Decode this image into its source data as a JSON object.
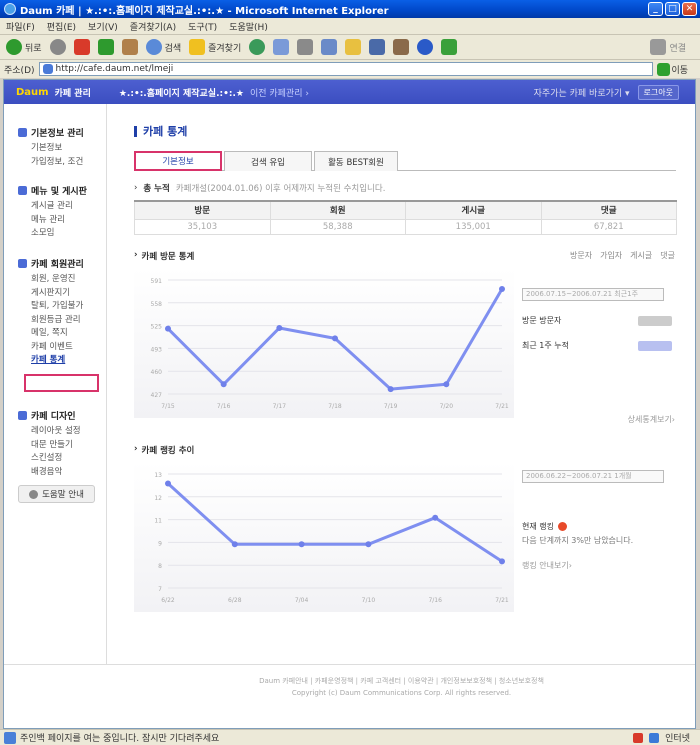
{
  "window": {
    "title": "Daum 카페 | ★.:•:.홈페이지 제작교실.:•:.★ - Microsoft Internet Explorer"
  },
  "menu": [
    "파일(F)",
    "편집(E)",
    "보기(V)",
    "즐겨찾기(A)",
    "도구(T)",
    "도움말(H)"
  ],
  "toolbar": {
    "back": "뒤로",
    "search": "검색",
    "favorites": "즐겨찾기",
    "connect": "연결"
  },
  "address": {
    "label": "주소(D)",
    "url": "http://cafe.daum.net/lmeji",
    "go": "이동"
  },
  "cafebar": {
    "logo": "Daum",
    "title": "카페 관리",
    "cafe_name": "★.:•:.홈페이지 제작교실.:•:.★",
    "prev": "이전 카페관리 ›",
    "favorite_cafes": "자주가는 카페 바로가기 ▾",
    "logout": "로그아웃"
  },
  "sidebar": {
    "basic": {
      "title": "기본정보 관리",
      "items": [
        "기본정보",
        "가입정보, 조건"
      ]
    },
    "menu": {
      "title": "메뉴 및 게시판",
      "items": [
        "게시글 관리",
        "메뉴 관리",
        "소모임"
      ]
    },
    "members": {
      "title": "카페 회원관리",
      "items": [
        "회원, 운영진",
        "게시판지기",
        "탈퇴, 가입불가",
        "회원등급 관리",
        "메일, 쪽지",
        "카페 이벤트",
        "카페 통계"
      ]
    },
    "design": {
      "title": "카페 디자인",
      "items": [
        "레이아웃 설정",
        "대문 만들기",
        "스킨설정",
        "배경음악"
      ]
    },
    "help": "도움말 안내"
  },
  "content": {
    "title": "카페 통계",
    "tabs": [
      "기본정보",
      "검색 유입",
      "활동 BEST회원"
    ],
    "summary_label": "총 누적",
    "summary_desc": "카페개설(2004.01.06) 이후 어제까지 누적된 수치입니다.",
    "stats_headers": [
      "방문",
      "회원",
      "게시글",
      "댓글"
    ],
    "stats_values": [
      "35,103",
      "58,388",
      "135,001",
      "67,821"
    ],
    "chart1": {
      "title": "카페 방문 통계",
      "links": [
        "방문자",
        "가입자",
        "게시글",
        "댓글"
      ],
      "date_range": "2006.07.15~2006.07.21 최근1주",
      "visitors_label": "방문 방문자",
      "cumulative_label": "최근 1주 누적",
      "more": "상세통계보기›"
    },
    "chart2": {
      "title": "카페 랭킹 추이",
      "date_range": "2006.06.22~2006.07.21 1개월",
      "rank_label": "현재 랭킹",
      "rank_text": "다음 단계까지 3%만 남았습니다.",
      "more": "랭킹 안내보기›"
    }
  },
  "chart_data": [
    {
      "type": "line",
      "title": "카페 방문 통계",
      "x": [
        "7/15",
        "7/16",
        "7/17",
        "7/18",
        "7/19",
        "7/20",
        "7/21"
      ],
      "values": [
        521,
        441,
        522,
        507,
        434,
        441,
        578
      ],
      "ylim": [
        427,
        591
      ]
    },
    {
      "type": "line",
      "title": "카페 랭킹 추이",
      "x": [
        "6/22",
        "6/28",
        "7/04",
        "7/10",
        "7/16",
        "7/21"
      ],
      "values": [
        12.5,
        9.3,
        9.3,
        9.3,
        10.7,
        8.4
      ],
      "ylim": [
        7.0,
        13.0
      ]
    }
  ],
  "footer": {
    "links": "Daum 카페안내 | 카페운영정책 | 카페 고객센터 | 이용약관 | 개인정보보호정책 | 청소년보호정책",
    "copyright": "Copyright (c) Daum Communications Corp. All rights reserved."
  },
  "status": {
    "text": "주인백 페이지를 여는 중입니다. 잠시만 기다려주세요",
    "zone": "인터넷"
  }
}
